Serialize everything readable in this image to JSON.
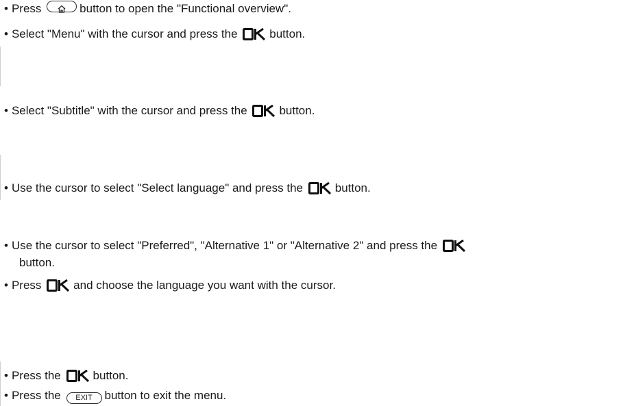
{
  "steps": [
    {
      "prefix": "Press",
      "button": "home",
      "suffix": "button to open the \"Functional overview\"."
    },
    {
      "prefix": "Select \"Menu\" with the cursor and press the",
      "button": "ok",
      "suffix": "button."
    },
    {
      "prefix": "Select \"Subtitle\" with the cursor and press the",
      "button": "ok",
      "suffix": "button."
    },
    {
      "prefix": "Use the cursor to select \"Select language\" and press the",
      "button": "ok",
      "suffix": "button."
    },
    {
      "prefix": "Use the cursor to select \"Preferred\", \"Alternative 1\" or \"Alternative 2\" and press the",
      "button": "ok",
      "suffix": "",
      "continuation": "button."
    },
    {
      "prefix": "Press",
      "button": "ok",
      "suffix": "and choose the language you want with the cursor."
    },
    {
      "prefix": "Press the",
      "button": "ok",
      "suffix": "button."
    },
    {
      "prefix": "Press the",
      "button": "exit",
      "suffix": "button to exit the menu."
    }
  ],
  "buttons": {
    "exit_label": "EXIT",
    "home_icon": "home-icon",
    "ok_icon": "ok-icon"
  },
  "bullet": "•",
  "colors": {
    "text": "#1a1a1a",
    "rule": "#cfcfcf"
  }
}
